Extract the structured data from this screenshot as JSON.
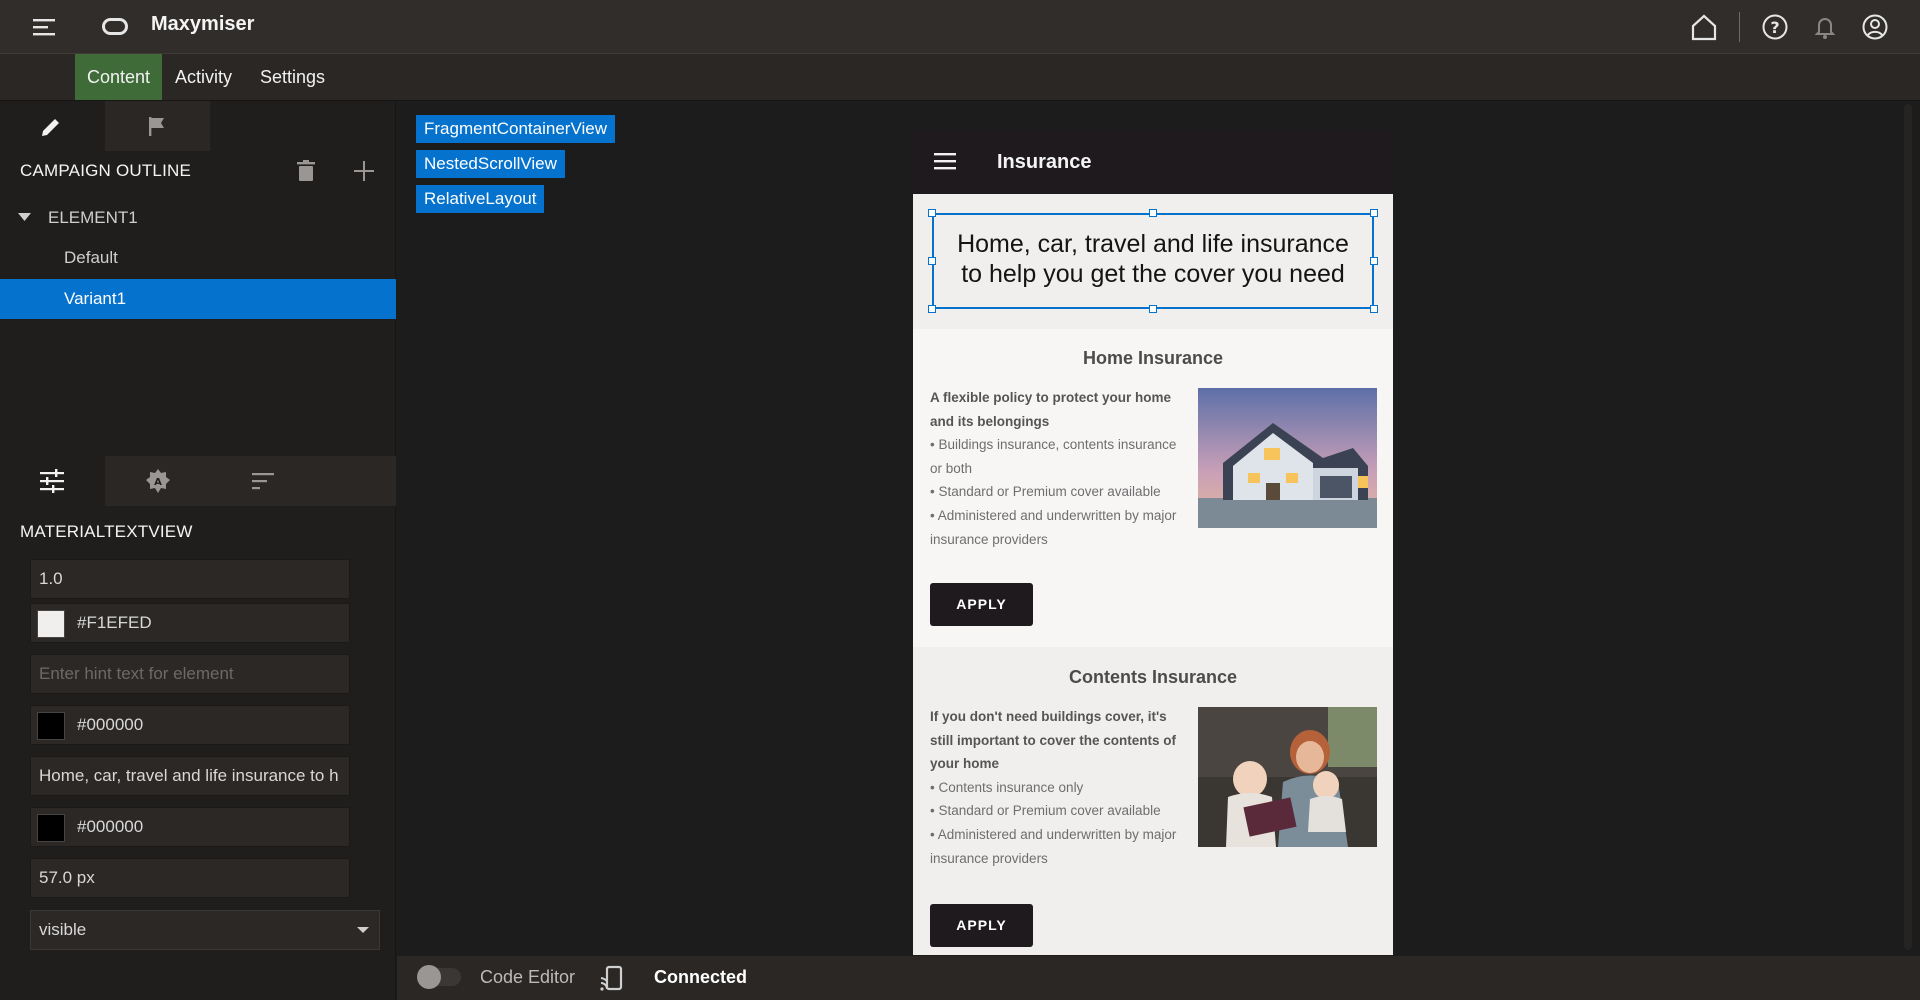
{
  "app": {
    "title": "Maxymiser"
  },
  "menubar": {
    "tabs": [
      "Content",
      "Activity",
      "Settings"
    ]
  },
  "campaign": {
    "heading": "CAMPAIGN OUTLINE",
    "element": "ELEMENT1",
    "variants": [
      "Default",
      "Variant1"
    ]
  },
  "properties": {
    "heading": "MATERIALTEXTVIEW",
    "alpha": "1.0",
    "background_color": "#F1EFED",
    "hint_placeholder": "Enter hint text for element",
    "hint_color": "#000000",
    "text": "Home, car, travel and life insurance to h",
    "text_color": "#000000",
    "text_size": "57.0 px",
    "visibility": "visible"
  },
  "hierarchy": [
    "FragmentContainerView",
    "NestedScrollView",
    "RelativeLayout"
  ],
  "preview": {
    "toolbar_title": "Insurance",
    "headline": "Home, car, travel and life insurance to help you get the cover you need",
    "cards": [
      {
        "title": "Home Insurance",
        "lead": "A flexible policy to protect your home and its belongings",
        "bullets": [
          "• Buildings insurance, contents insurance or both",
          "• Standard or Premium cover available",
          "• Administered and underwritten by major insurance providers"
        ],
        "button": "APPLY"
      },
      {
        "title": "Contents Insurance",
        "lead": "If you don't need buildings cover, it's still important to cover the contents of your home",
        "bullets": [
          "• Contents insurance only",
          "• Standard or Premium cover available",
          "• Administered and underwritten by major insurance providers"
        ],
        "button": "APPLY"
      }
    ]
  },
  "bottombar": {
    "code_editor": "Code Editor",
    "status": "Connected"
  },
  "colors": {
    "accent": "#0572ce",
    "active_tab": "#3e6b38",
    "preview_bg": "#F1EFED"
  }
}
